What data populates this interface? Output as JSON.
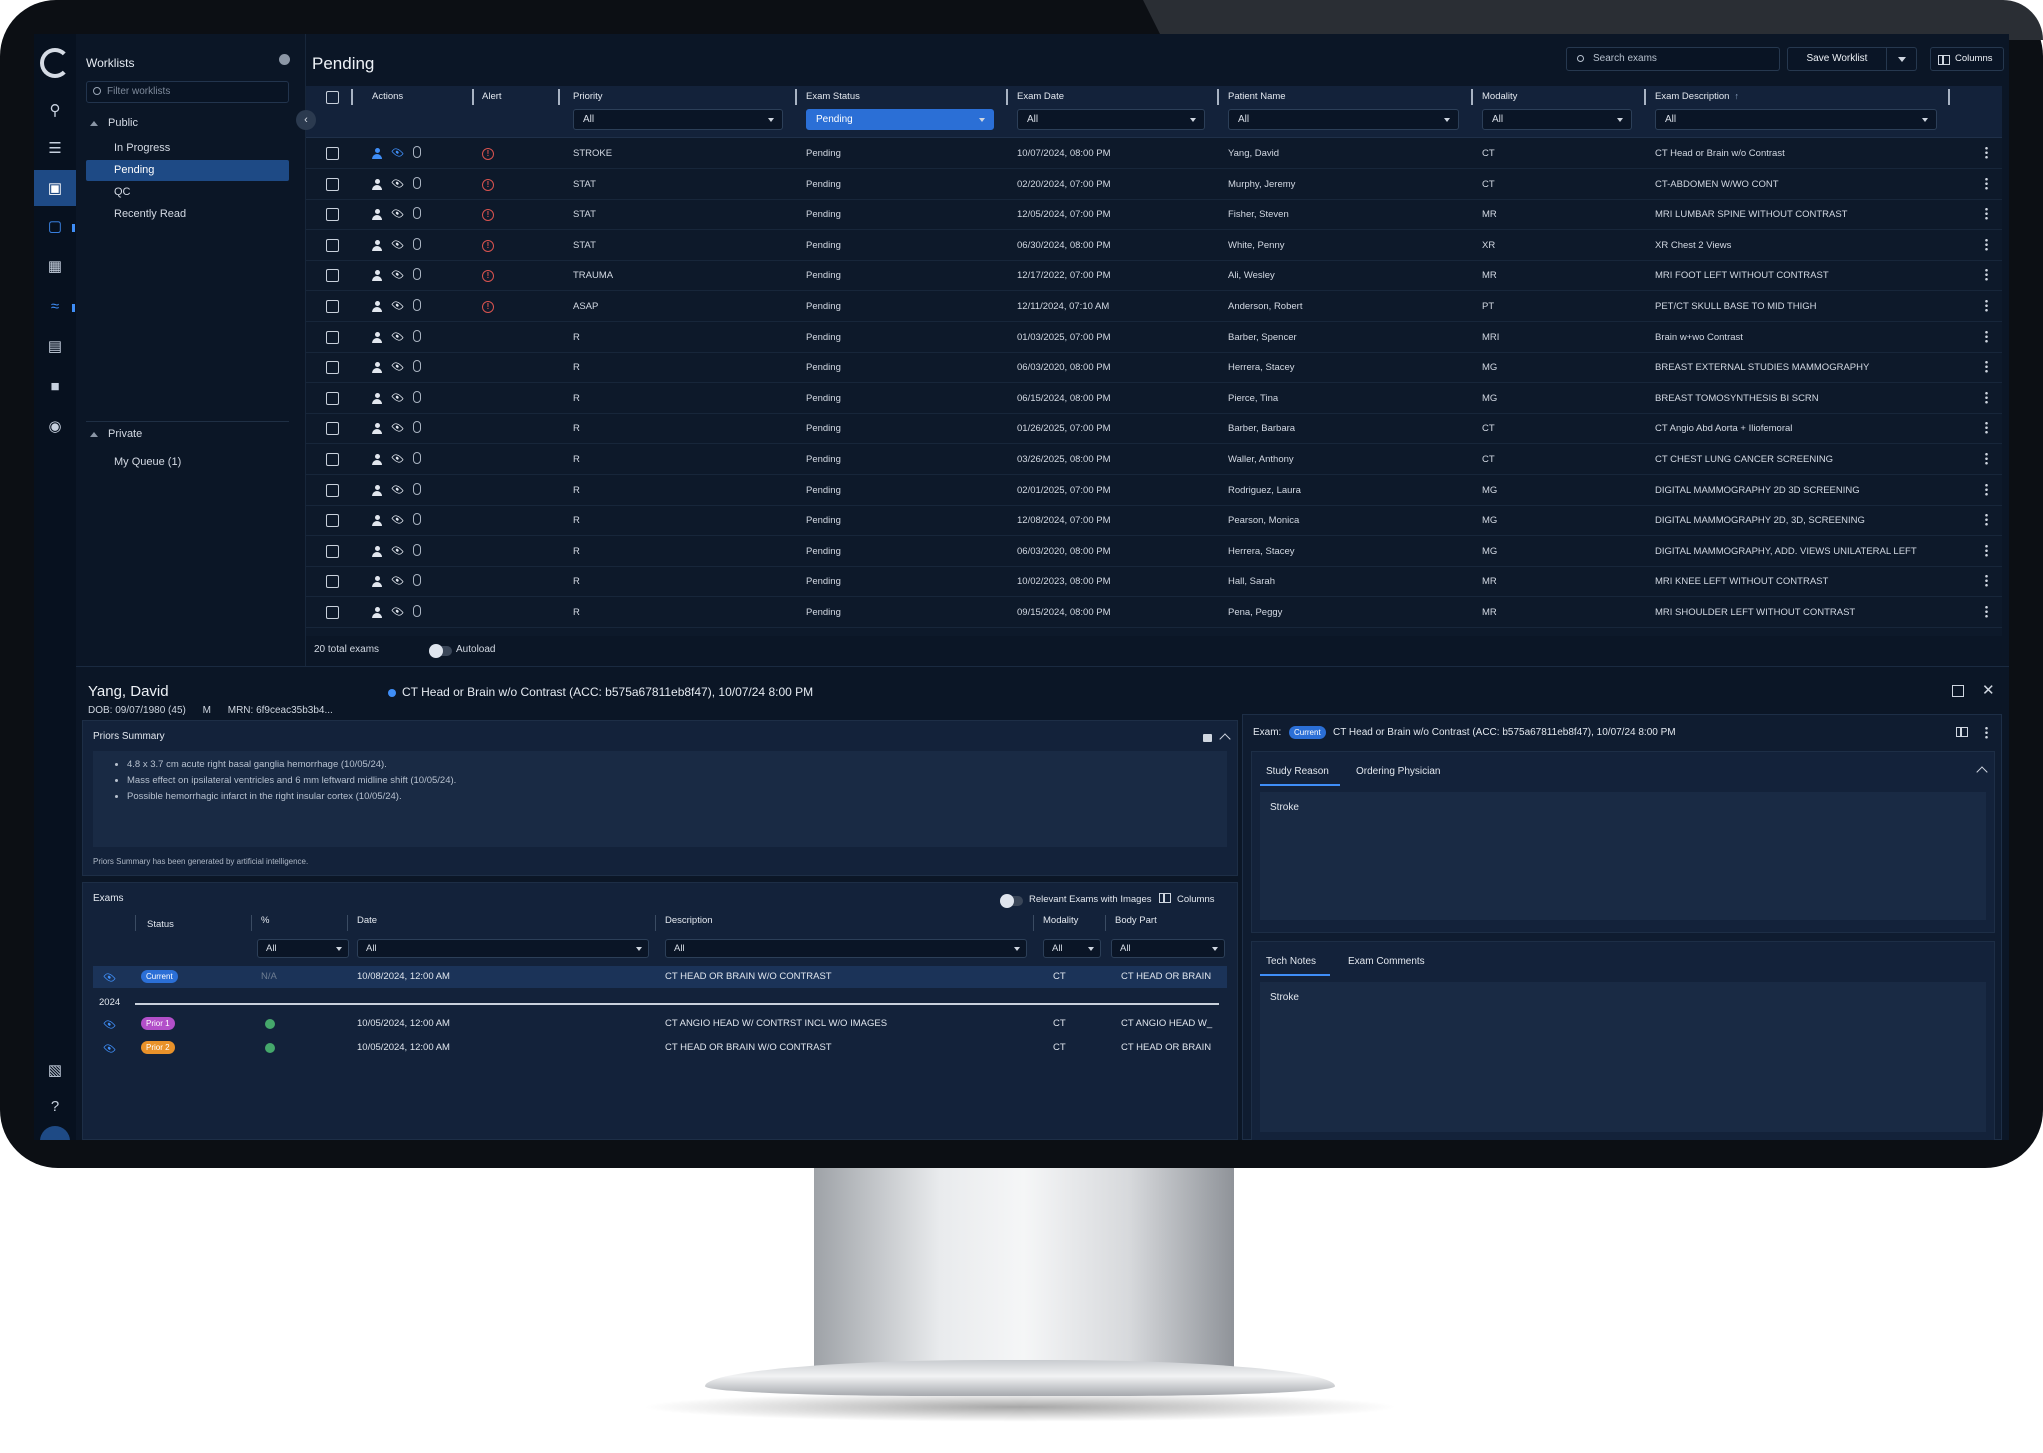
{
  "sidebar": {
    "title": "Worklists",
    "filter_placeholder": "Filter worklists",
    "public_label": "Public",
    "public_items": [
      "In Progress",
      "Pending",
      "QC",
      "Recently Read"
    ],
    "private_label": "Private",
    "private_items": [
      "My Queue (1)"
    ]
  },
  "toolbar": {
    "page_title": "Pending",
    "search_placeholder": "Search exams",
    "save_label": "Save Worklist",
    "columns_label": "Columns"
  },
  "grid": {
    "headers": [
      "Actions",
      "Alert",
      "Priority",
      "Exam Status",
      "Exam Date",
      "Patient Name",
      "Modality",
      "Exam Description"
    ],
    "filters": [
      "All",
      "Pending",
      "All",
      "All",
      "All",
      "All"
    ],
    "rows": [
      {
        "priority": "STROKE",
        "status": "Pending",
        "date": "10/07/2024, 08:00 PM",
        "patient": "Yang, David",
        "modality": "CT",
        "description": "CT Head or Brain w/o Contrast",
        "alert": true
      },
      {
        "priority": "STAT",
        "status": "Pending",
        "date": "02/20/2024, 07:00 PM",
        "patient": "Murphy, Jeremy",
        "modality": "CT",
        "description": "CT-ABDOMEN W/WO CONT",
        "alert": true
      },
      {
        "priority": "STAT",
        "status": "Pending",
        "date": "12/05/2024, 07:00 PM",
        "patient": "Fisher, Steven",
        "modality": "MR",
        "description": "MRI LUMBAR SPINE WITHOUT CONTRAST",
        "alert": true
      },
      {
        "priority": "STAT",
        "status": "Pending",
        "date": "06/30/2024, 08:00 PM",
        "patient": "White, Penny",
        "modality": "XR",
        "description": "XR Chest 2 Views",
        "alert": true
      },
      {
        "priority": "TRAUMA",
        "status": "Pending",
        "date": "12/17/2022, 07:00 PM",
        "patient": "Ali, Wesley",
        "modality": "MR",
        "description": "MRI FOOT LEFT WITHOUT CONTRAST",
        "alert": true
      },
      {
        "priority": "ASAP",
        "status": "Pending",
        "date": "12/11/2024, 07:10 AM",
        "patient": "Anderson, Robert",
        "modality": "PT",
        "description": "PET/CT SKULL BASE TO MID THIGH",
        "alert": true
      },
      {
        "priority": "R",
        "status": "Pending",
        "date": "01/03/2025, 07:00 PM",
        "patient": "Barber, Spencer",
        "modality": "MRI",
        "description": "Brain w+wo Contrast",
        "alert": false
      },
      {
        "priority": "R",
        "status": "Pending",
        "date": "06/03/2020, 08:00 PM",
        "patient": "Herrera, Stacey",
        "modality": "MG",
        "description": "BREAST EXTERNAL STUDIES MAMMOGRAPHY",
        "alert": false
      },
      {
        "priority": "R",
        "status": "Pending",
        "date": "06/15/2024, 08:00 PM",
        "patient": "Pierce, Tina",
        "modality": "MG",
        "description": "BREAST TOMOSYNTHESIS BI SCRN",
        "alert": false
      },
      {
        "priority": "R",
        "status": "Pending",
        "date": "01/26/2025, 07:00 PM",
        "patient": "Barber, Barbara",
        "modality": "CT",
        "description": "CT Angio Abd Aorta + Iliofemoral",
        "alert": false
      },
      {
        "priority": "R",
        "status": "Pending",
        "date": "03/26/2025, 08:00 PM",
        "patient": "Waller, Anthony",
        "modality": "CT",
        "description": "CT CHEST LUNG CANCER SCREENING",
        "alert": false
      },
      {
        "priority": "R",
        "status": "Pending",
        "date": "02/01/2025, 07:00 PM",
        "patient": "Rodriguez, Laura",
        "modality": "MG",
        "description": "DIGITAL MAMMOGRAPHY 2D 3D SCREENING",
        "alert": false
      },
      {
        "priority": "R",
        "status": "Pending",
        "date": "12/08/2024, 07:00 PM",
        "patient": "Pearson, Monica",
        "modality": "MG",
        "description": "DIGITAL MAMMOGRAPHY 2D, 3D, SCREENING",
        "alert": false
      },
      {
        "priority": "R",
        "status": "Pending",
        "date": "06/03/2020, 08:00 PM",
        "patient": "Herrera, Stacey",
        "modality": "MG",
        "description": "DIGITAL MAMMOGRAPHY, ADD. VIEWS UNILATERAL LEFT",
        "alert": false
      },
      {
        "priority": "R",
        "status": "Pending",
        "date": "10/02/2023, 08:00 PM",
        "patient": "Hall, Sarah",
        "modality": "MR",
        "description": "MRI KNEE LEFT WITHOUT CONTRAST",
        "alert": false
      },
      {
        "priority": "R",
        "status": "Pending",
        "date": "09/15/2024, 08:00 PM",
        "patient": "Pena, Peggy",
        "modality": "MR",
        "description": "MRI SHOULDER LEFT WITHOUT CONTRAST",
        "alert": false
      }
    ],
    "total_label": "20 total exams",
    "autoload_label": "Autoload"
  },
  "patient": {
    "name": "Yang, David",
    "dob": "DOB: 09/07/1980 (45)",
    "sex": "M",
    "mrn": "MRN: 6f9ceac35b3b4...",
    "exam_title": "CT Head or Brain w/o Contrast (ACC: b575a67811eb8f47), 10/07/24 8:00 PM"
  },
  "priors": {
    "title": "Priors Summary",
    "items": [
      "4.8 x 3.7 cm acute right basal ganglia hemorrhage (10/05/24).",
      "Mass effect on ipsilateral ventricles and 6 mm leftward midline shift (10/05/24).",
      "Possible hemorrhagic infarct in the right insular cortex (10/05/24)."
    ],
    "footnote": "Priors Summary has been generated by artificial intelligence."
  },
  "exams": {
    "title": "Exams",
    "relevant_label": "Relevant Exams with Images",
    "columns_label": "Columns",
    "headers": [
      "Status",
      "%",
      "Date",
      "Description",
      "Modality",
      "Body Part"
    ],
    "filters": [
      "All",
      "All",
      "All",
      "All",
      "All"
    ],
    "current": {
      "badge": "Current",
      "pct": "N/A",
      "date": "10/08/2024, 12:00 AM",
      "description": "CT HEAD OR BRAIN W/O CONTRAST",
      "modality": "CT",
      "body": "CT HEAD OR BRAIN"
    },
    "year": "2024",
    "priors": [
      {
        "badge": "Prior 1",
        "date": "10/05/2024, 12:00 AM",
        "description": "CT ANGIO HEAD W/ CONTRST INCL W/O IMAGES",
        "modality": "CT",
        "body": "CT ANGIO HEAD W_"
      },
      {
        "badge": "Prior 2",
        "date": "10/05/2024, 12:00 AM",
        "description": "CT HEAD OR BRAIN W/O CONTRAST",
        "modality": "CT",
        "body": "CT HEAD OR BRAIN"
      }
    ]
  },
  "exam_panel": {
    "label": "Exam:",
    "badge": "Current",
    "title": "CT Head or Brain w/o Contrast (ACC: b575a67811eb8f47), 10/07/24 8:00 PM",
    "tab1": "Study Reason",
    "tab2": "Ordering Physician",
    "reason_text": "Stroke",
    "tab3": "Tech Notes",
    "tab4": "Exam Comments",
    "notes_text": "Stroke"
  },
  "colors": {
    "accent": "#3f8ef7",
    "selected": "#1e4a85",
    "alert": "#d9534f",
    "prior1": "#b24fc9",
    "prior2": "#e9922a",
    "current": "#2b6fd6"
  }
}
